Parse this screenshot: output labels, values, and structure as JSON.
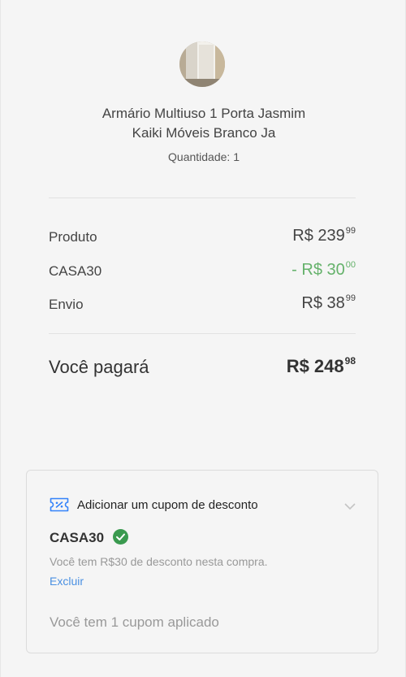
{
  "product": {
    "image_alt": "product-thumbnail",
    "title_line1": "Armário Multiuso 1 Porta Jasmim",
    "title_line2": "Kaiki Móveis Branco Ja",
    "quantity_label": "Quantidade: 1"
  },
  "summary": {
    "rows": [
      {
        "label": "Produto",
        "amount_main": "R$ 239",
        "amount_cents": "99"
      },
      {
        "label": "CASA30",
        "amount_main": "- R$ 30",
        "amount_cents": "00"
      },
      {
        "label": "Envio",
        "amount_main": "R$ 38",
        "amount_cents": "99"
      }
    ],
    "total": {
      "label": "Você pagará",
      "amount_main": "R$ 248",
      "amount_cents": "98"
    }
  },
  "coupon": {
    "header": "Adicionar um cupom de desconto",
    "code": "CASA30",
    "note": "Você tem R$30 de desconto nesta compra.",
    "remove_label": "Excluir",
    "applied_text": "Você tem 1 cupom aplicado"
  },
  "colors": {
    "discount_green": "#65b26b",
    "check_green": "#3a9a4f",
    "link_blue": "#4a90e2",
    "coupon_icon_blue": "#3483fa"
  }
}
